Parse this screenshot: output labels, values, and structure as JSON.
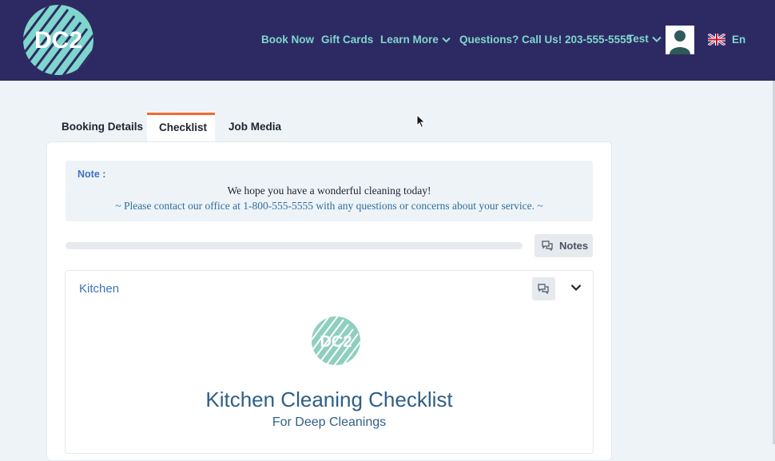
{
  "header": {
    "logo_text": "DC2",
    "nav": [
      {
        "label": "Book Now"
      },
      {
        "label": "Gift Cards"
      },
      {
        "label": "Learn More"
      },
      {
        "label": "Questions? Call Us! 203-555-5555"
      }
    ],
    "user_name": "Test",
    "language": "En",
    "icons": [
      "chevron-down-icon",
      "avatar-icon",
      "uk-flag-icon"
    ],
    "colors": {
      "background": "#2d2a63",
      "nav_text": "#7fd6cc"
    }
  },
  "tabs": [
    {
      "label": "Booking Details",
      "active": false
    },
    {
      "label": "Checklist",
      "active": true
    },
    {
      "label": "Job Media",
      "active": false
    }
  ],
  "note": {
    "label": "Note :",
    "line1": "We hope you have a wonderful cleaning today!",
    "line2": "~ Please contact our office at 1-800-555-5555 with any questions or concerns about your service. ~"
  },
  "progress": {
    "value": 0
  },
  "notes_button": {
    "label": "Notes"
  },
  "section": {
    "title": "Kitchen",
    "logo_text": "DC2",
    "checklist_title": "Kitchen Cleaning Checklist",
    "checklist_subtitle": "For Deep Cleanings"
  },
  "accent_color": "#f26a2e"
}
